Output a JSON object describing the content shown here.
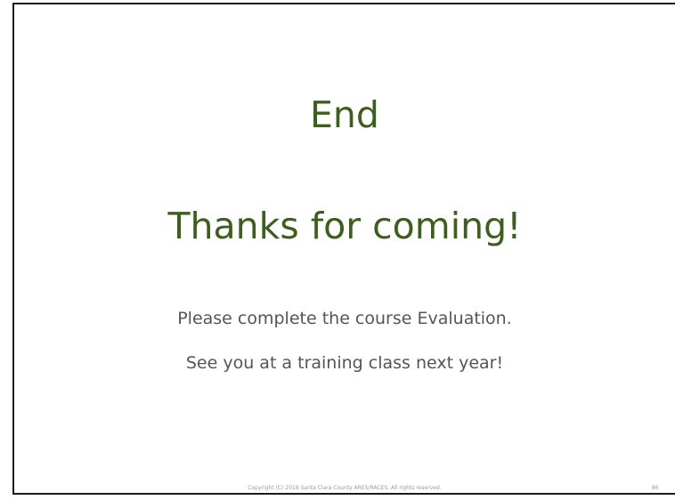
{
  "slide": {
    "title": "End",
    "subtitle": "Thanks for coming!",
    "body_lines": [
      "Please complete the course Evaluation.",
      "See you at a training class next year!"
    ],
    "footer": {
      "copyright": "Copyright (C) 2018 Santa Clara County ARES/RACES. All rights reserved.",
      "page_number": "86"
    },
    "colors": {
      "title": "#3d5e1e",
      "body": "#555555",
      "footer": "#9a9a9a",
      "border": "#1a1a1a"
    }
  }
}
